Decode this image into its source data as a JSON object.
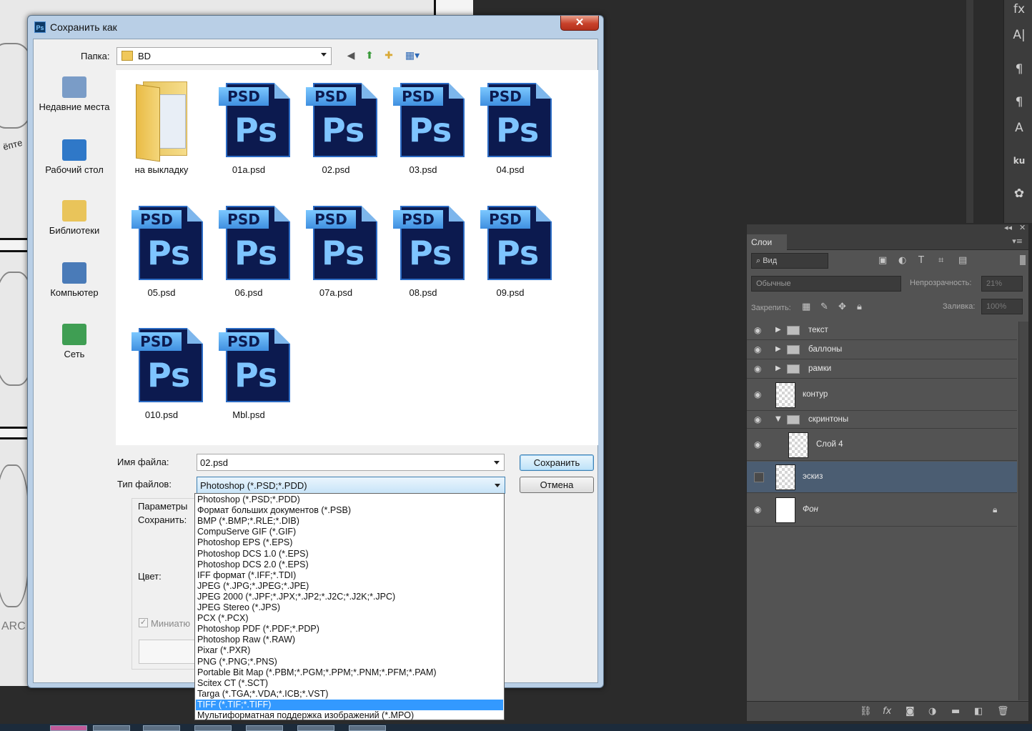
{
  "dialog": {
    "title": "Сохранить как",
    "app_icon": "Ps",
    "close_glyph": "✕",
    "folder_label": "Папка:",
    "folder_value": "BD",
    "places": [
      {
        "label": "Недавние места",
        "icon": "recent-places-icon",
        "color": "#7a9cc7"
      },
      {
        "label": "Рабочий стол",
        "icon": "desktop-icon",
        "color": "#2f78c8"
      },
      {
        "label": "Библиотеки",
        "icon": "libraries-icon",
        "color": "#e9c45a"
      },
      {
        "label": "Компьютер",
        "icon": "computer-icon",
        "color": "#4a7bb8"
      },
      {
        "label": "Сеть",
        "icon": "network-icon",
        "color": "#3f9e53"
      }
    ],
    "files": [
      {
        "name": "на выкладку",
        "type": "folder"
      },
      {
        "name": "01a.psd",
        "type": "psd"
      },
      {
        "name": "02.psd",
        "type": "psd"
      },
      {
        "name": "03.psd",
        "type": "psd"
      },
      {
        "name": "04.psd",
        "type": "psd"
      },
      {
        "name": "05.psd",
        "type": "psd"
      },
      {
        "name": "06.psd",
        "type": "psd"
      },
      {
        "name": "07a.psd",
        "type": "psd"
      },
      {
        "name": "08.psd",
        "type": "psd"
      },
      {
        "name": "09.psd",
        "type": "psd"
      },
      {
        "name": "010.psd",
        "type": "psd"
      },
      {
        "name": "Mbl.psd",
        "type": "psd"
      }
    ],
    "psd_band": "PSD",
    "psd_mark": "Ps",
    "filename_label": "Имя файла:",
    "filename_value": "02.psd",
    "filetype_label": "Тип файлов:",
    "filetype_value": "Photoshop (*.PSD;*.PDD)",
    "save_button": "Сохранить",
    "cancel_button": "Отмена",
    "options_label": "Параметры",
    "save_label": "Сохранить:",
    "color_label": "Цвет:",
    "thumbnail_label": "Миниатю",
    "filetype_options": [
      "Photoshop (*.PSD;*.PDD)",
      "Формат больших документов (*.PSB)",
      "BMP (*.BMP;*.RLE;*.DIB)",
      "CompuServe GIF (*.GIF)",
      "Photoshop EPS (*.EPS)",
      "Photoshop DCS 1.0 (*.EPS)",
      "Photoshop DCS 2.0 (*.EPS)",
      "IFF формат (*.IFF;*.TDI)",
      "JPEG (*.JPG;*.JPEG;*.JPE)",
      "JPEG 2000 (*.JPF;*.JPX;*.JP2;*.J2C;*.J2K;*.JPC)",
      "JPEG Stereo (*.JPS)",
      "PCX (*.PCX)",
      "Photoshop PDF (*.PDF;*.PDP)",
      "Photoshop Raw (*.RAW)",
      "Pixar (*.PXR)",
      "PNG (*.PNG;*.PNS)",
      "Portable Bit Map (*.PBM;*.PGM;*.PPM;*.PNM;*.PFM;*.PAM)",
      "Scitex CT (*.SCT)",
      "Targa (*.TGA;*.VDA;*.ICB;*.VST)",
      "TIFF (*.TIF;*.TIFF)",
      "Мультиформатная поддержка изображений (*.MPO)"
    ],
    "selected_option_index": 19
  },
  "canvas": {
    "text1": "ёптe",
    "text2": "ARC"
  },
  "layers_panel": {
    "tab": "Слои",
    "collapse_glyph": "◂◂",
    "close_glyph": "✕",
    "menu_glyph": "▾≡",
    "filter_kind": "Вид",
    "blend_mode": "Обычные",
    "opacity_label": "Непрозрачность:",
    "opacity_value": "21%",
    "lock_label": "Закрепить:",
    "fill_label": "Заливка:",
    "fill_value": "100%",
    "layers": [
      {
        "name": "текст",
        "kind": "group",
        "visible": true,
        "expanded": false
      },
      {
        "name": "баллоны",
        "kind": "group",
        "visible": true,
        "expanded": false
      },
      {
        "name": "рамки",
        "kind": "group",
        "visible": true,
        "expanded": false
      },
      {
        "name": "контур",
        "kind": "layer",
        "visible": true
      },
      {
        "name": "скринтоны",
        "kind": "group",
        "visible": true,
        "expanded": true
      },
      {
        "name": "Слой 4",
        "kind": "layer",
        "visible": true,
        "indent": true
      },
      {
        "name": "эскиз",
        "kind": "layer",
        "visible": false,
        "selected": true
      },
      {
        "name": "Фон",
        "kind": "background",
        "visible": true,
        "locked": true
      }
    ]
  },
  "right_toolbar": {
    "icons": [
      "fx",
      "A|",
      "¶",
      "¶",
      "A",
      "ku",
      "✿"
    ]
  },
  "colors": {
    "selection": "#3399ff",
    "layer_selected": "#4b5d72",
    "psd_dark": "#0c1a4f",
    "psd_light": "#7cc8ff"
  }
}
